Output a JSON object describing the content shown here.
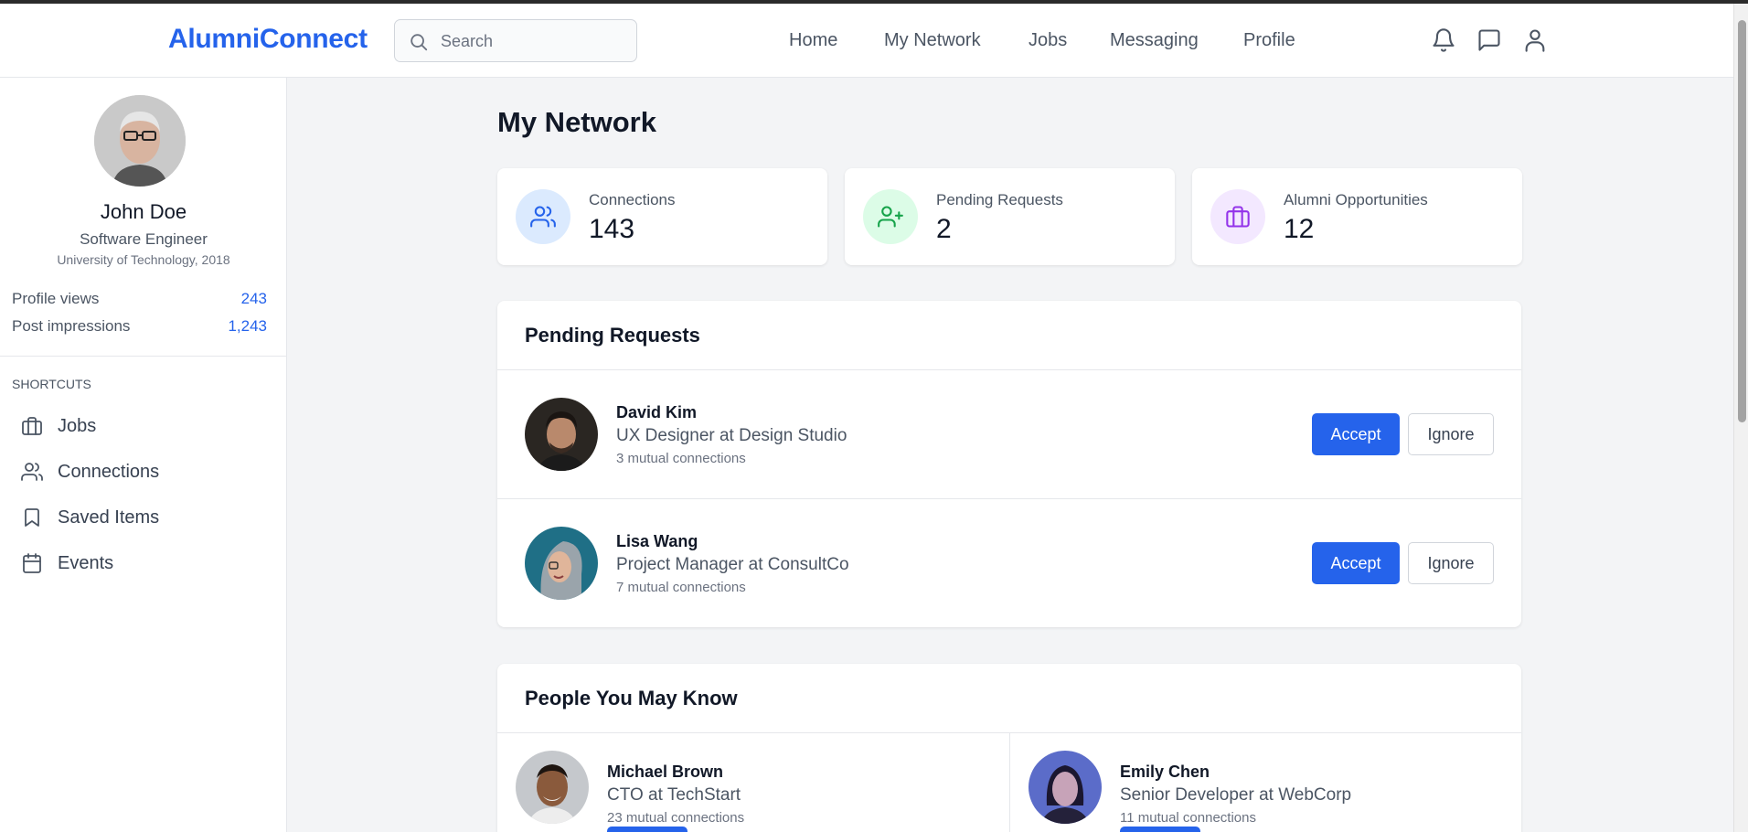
{
  "app": {
    "logo": "AlumniConnect"
  },
  "header": {
    "search": {
      "placeholder": "Search",
      "value": ""
    },
    "nav": [
      "Home",
      "My Network",
      "Jobs",
      "Messaging",
      "Profile"
    ],
    "icons": [
      "bell-icon",
      "message-icon",
      "user-icon"
    ]
  },
  "sidebar": {
    "profile": {
      "name": "John Doe",
      "title": "Software Engineer",
      "school": "University of Technology, 2018"
    },
    "stats": [
      {
        "label": "Profile views",
        "value": "243"
      },
      {
        "label": "Post impressions",
        "value": "1,243"
      }
    ],
    "shortcuts_title": "SHORTCUTS",
    "shortcuts": [
      {
        "label": "Jobs",
        "icon": "briefcase-icon"
      },
      {
        "label": "Connections",
        "icon": "users-icon"
      },
      {
        "label": "Saved Items",
        "icon": "bookmark-icon"
      },
      {
        "label": "Events",
        "icon": "calendar-icon"
      }
    ]
  },
  "main": {
    "title": "My Network",
    "stat_cards": [
      {
        "label": "Connections",
        "value": "143",
        "icon": "users-icon",
        "color": "#2563eb",
        "bg": "#dbeafe"
      },
      {
        "label": "Pending Requests",
        "value": "2",
        "icon": "user-plus-icon",
        "color": "#16a34a",
        "bg": "#dcfce7"
      },
      {
        "label": "Alumni Opportunities",
        "value": "12",
        "icon": "briefcase-icon",
        "color": "#9333ea",
        "bg": "#f3e8ff"
      }
    ],
    "pending": {
      "title": "Pending Requests",
      "accept_label": "Accept",
      "ignore_label": "Ignore",
      "requests": [
        {
          "name": "David Kim",
          "title": "UX Designer at Design Studio",
          "mutual": "3 mutual connections"
        },
        {
          "name": "Lisa Wang",
          "title": "Project Manager at ConsultCo",
          "mutual": "7 mutual connections"
        }
      ]
    },
    "people": {
      "title": "People You May Know",
      "items": [
        {
          "name": "Michael Brown",
          "title": "CTO at TechStart",
          "mutual": "23 mutual connections"
        },
        {
          "name": "Emily Chen",
          "title": "Senior Developer at WebCorp",
          "mutual": "11 mutual connections"
        }
      ]
    }
  },
  "colors": {
    "accent": "#2563eb",
    "text": "#111827",
    "muted": "#4b5563",
    "bg": "#f3f4f6"
  }
}
